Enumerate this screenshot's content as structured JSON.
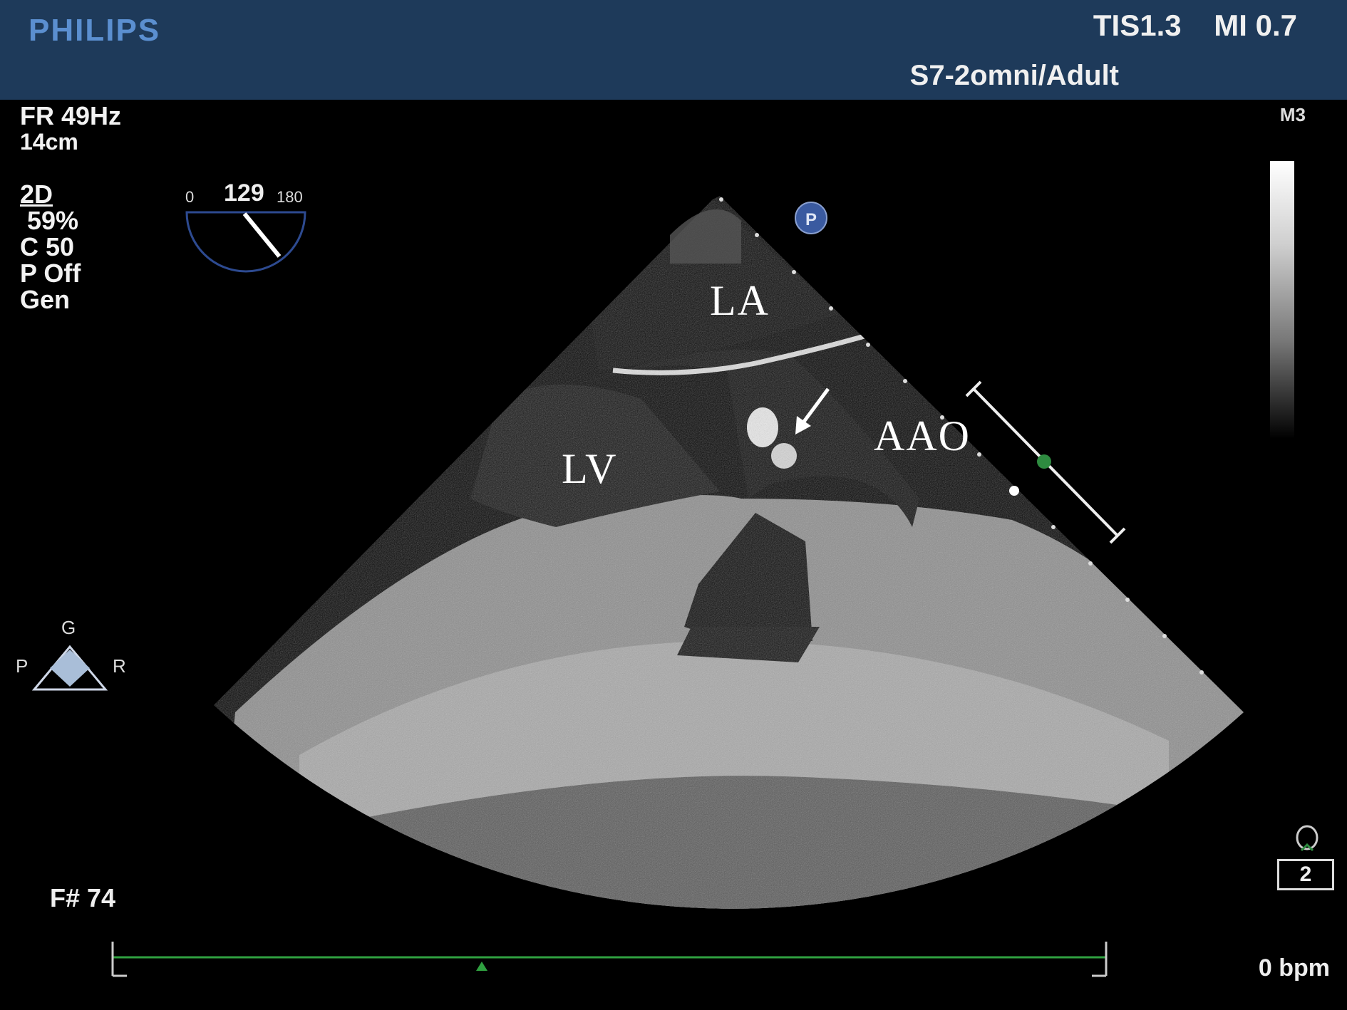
{
  "header": {
    "brand": "PHILIPS",
    "tis": "TIS1.3",
    "mi": "MI 0.7",
    "probe": "S7-2omni/Adult"
  },
  "settings": {
    "frame_rate": "FR 49Hz",
    "depth": "14cm",
    "mode": "2D",
    "gain": "59%",
    "compression": "C 50",
    "persistence": "P Off",
    "preset": "Gen"
  },
  "angle": {
    "min": "0",
    "value": "129",
    "max": "180"
  },
  "orientation": {
    "top": "G",
    "left": "P",
    "right": "R"
  },
  "map_label": "M3",
  "labels": {
    "la": "LA",
    "lv": "LV",
    "aao": "AAO"
  },
  "frame_number": "F# 74",
  "heart_rate": "0 bpm",
  "beat_count": "2",
  "colors": {
    "header_bg": "#1e3a5a",
    "brand": "#5b8fd0",
    "ecg_line": "#2fa040",
    "marker_green": "#2e8b40"
  }
}
